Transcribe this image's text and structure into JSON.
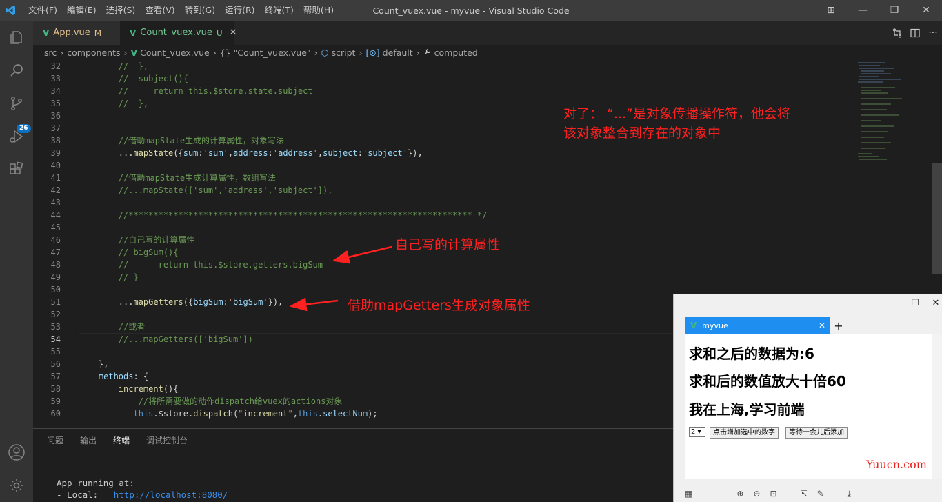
{
  "titlebar": {
    "menu": [
      "文件(F)",
      "编辑(E)",
      "选择(S)",
      "查看(V)",
      "转到(G)",
      "运行(R)",
      "终端(T)",
      "帮助(H)"
    ],
    "title": "Count_vuex.vue - myvue - Visual Studio Code",
    "controls": [
      "⊞",
      "—",
      "❐",
      "✕"
    ]
  },
  "activitybar": {
    "icons": [
      "explorer-icon",
      "search-icon",
      "source-control-icon",
      "run-debug-icon",
      "extensions-icon",
      "account-icon",
      "settings-gear-icon"
    ],
    "scm_badge": "26"
  },
  "tabs": [
    {
      "label": "App.vue",
      "status": "M"
    },
    {
      "label": "Count_vuex.vue",
      "status": "U",
      "close": "✕"
    }
  ],
  "breadcrumb": {
    "items": [
      "src",
      "components",
      "Count_vuex.vue",
      "\"Count_vuex.vue\"",
      "script",
      "default",
      "computed"
    ],
    "icons": [
      "",
      "",
      "V",
      "{}",
      "⬡",
      "[⊙]",
      "🔧"
    ]
  },
  "editor": {
    "lines": [
      {
        "n": "32",
        "t": "        //  },"
      },
      {
        "n": "33",
        "t": "        //  subject(){"
      },
      {
        "n": "34",
        "t": "        //     return this.$store.state.subject"
      },
      {
        "n": "35",
        "t": "        //  },"
      },
      {
        "n": "36",
        "t": ""
      },
      {
        "n": "37",
        "t": ""
      },
      {
        "n": "38",
        "t": "        //借助mapState生成的计算属性，对象写法"
      },
      {
        "n": "39",
        "t": "        ...mapState({sum:'sum',address:'address',subject:'subject'}),"
      },
      {
        "n": "40",
        "t": ""
      },
      {
        "n": "41",
        "t": "        //借助mapState生成计算属性，数组写法"
      },
      {
        "n": "42",
        "t": "        //...mapState(['sum','address','subject']),"
      },
      {
        "n": "43",
        "t": ""
      },
      {
        "n": "44",
        "t": "        //********************************************************************* */"
      },
      {
        "n": "45",
        "t": ""
      },
      {
        "n": "46",
        "t": "        //自己写的计算属性"
      },
      {
        "n": "47",
        "t": "        // bigSum(){"
      },
      {
        "n": "48",
        "t": "        //      return this.$store.getters.bigSum"
      },
      {
        "n": "49",
        "t": "        // }"
      },
      {
        "n": "50",
        "t": ""
      },
      {
        "n": "51",
        "t": "        ...mapGetters({bigSum:'bigSum'}),"
      },
      {
        "n": "52",
        "t": ""
      },
      {
        "n": "53",
        "t": "        //或者"
      },
      {
        "n": "54",
        "t": "        //...mapGetters(['bigSum'])"
      },
      {
        "n": "55",
        "t": ""
      },
      {
        "n": "56",
        "t": "    },"
      },
      {
        "n": "57",
        "t": "    methods: {"
      },
      {
        "n": "58",
        "t": "        increment(){"
      },
      {
        "n": "59",
        "t": "            //将所需要做的动作dispatch给vuex的actions对象"
      },
      {
        "n": "60",
        "t": "           this.$store.dispatch(\"increment\",this.selectNum);"
      }
    ]
  },
  "annotations": {
    "note1_line1": "对了：  “...”是对象传播操作符，他会将",
    "note1_line2": "该对象整合到存在的对象中",
    "note2": "自己写的计算属性",
    "note3": "借助mapGetters生成对象属性"
  },
  "panel": {
    "tabs": [
      "问题",
      "输出",
      "终端",
      "调试控制台"
    ],
    "active_tab": "终端",
    "terminal": {
      "line1": "App running at:",
      "line2_prefix": "- Local:   ",
      "line2_url": "http://localhost:8080/"
    }
  },
  "browser": {
    "tab_title": "myvue",
    "tab_close": "✕",
    "new_tab": "+",
    "win_controls": [
      "—",
      "☐",
      "✕"
    ],
    "heading1": "求和之后的数据为:6",
    "heading2": "求和后的数值放大十倍60",
    "heading3": "我在上海,学习前端",
    "select_value": "2 ▾",
    "button1": "点击增加选中的数字",
    "button2": "等待一会儿后添加"
  },
  "watermark": "Yuucn.com",
  "colors": {
    "titlebar": "#3c3c3c",
    "activitybar": "#333333",
    "editor_bg": "#1e1e1e",
    "comment": "#6a9955",
    "keyword": "#569cd6",
    "annotation_red": "#ff2020",
    "browser_tab": "#1f8ef1"
  }
}
